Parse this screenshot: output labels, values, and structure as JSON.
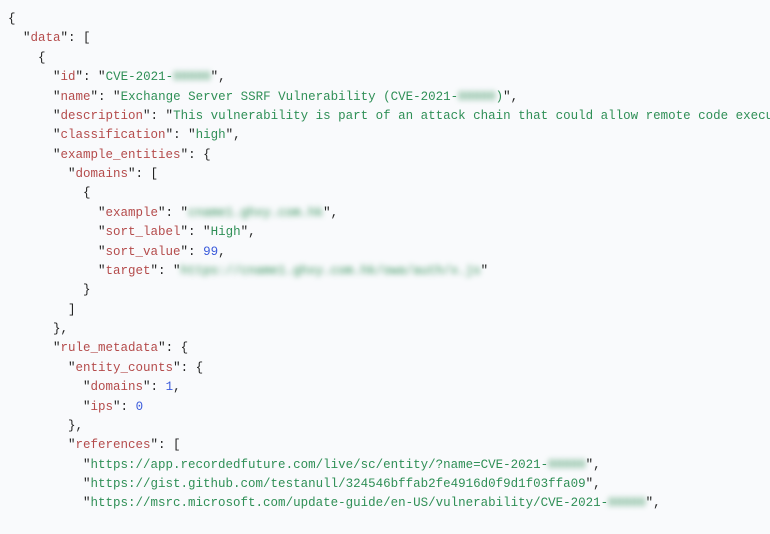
{
  "json": {
    "data_key": "data",
    "id_key": "id",
    "id_prefix": "CVE-2021-",
    "id_redacted": "00000",
    "name_key": "name",
    "name_prefix": "Exchange Server SSRF Vulnerability (CVE-2021-",
    "name_redacted": "00000",
    "name_suffix": ")",
    "description_key": "description",
    "description_value": "This vulnerability is part of an attack chain that could allow remote code execution",
    "classification_key": "classification",
    "classification_value": "high",
    "example_entities_key": "example_entities",
    "domains_key": "domains",
    "example_key": "example",
    "example_redacted": "cname1.ghxy.com.hk",
    "sort_label_key": "sort_label",
    "sort_label_value": "High",
    "sort_value_key": "sort_value",
    "sort_value_value": 99,
    "target_key": "target",
    "target_redacted": "https://cname1.ghxy.com.hk/owa/auth/x.js",
    "rule_metadata_key": "rule_metadata",
    "entity_counts_key": "entity_counts",
    "ec_domains_key": "domains",
    "ec_domains_value": 1,
    "ec_ips_key": "ips",
    "ec_ips_value": 0,
    "references_key": "references",
    "ref0_prefix": "https://app.recordedfuture.com/live/sc/entity/?name=CVE-2021-",
    "ref0_redacted": "00000",
    "ref1": "https://gist.github.com/testanull/324546bffab2fe4916d0f9d1f03ffa09",
    "ref2_prefix": "https://msrc.microsoft.com/update-guide/en-US/vulnerability/CVE-2021-",
    "ref2_redacted": "00000"
  }
}
